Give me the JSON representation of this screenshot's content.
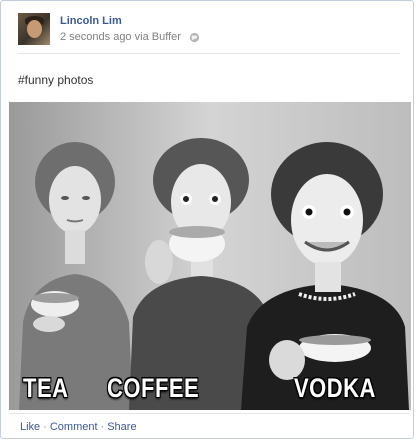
{
  "post": {
    "author": "Lincoln Lim",
    "timestamp": "2 seconds ago",
    "via": "via Buffer",
    "privacy_icon": "globe-icon",
    "message": "#funny photos",
    "photo": {
      "captions": [
        "TEA",
        "COFFEE",
        "VODKA"
      ]
    },
    "actions": {
      "like": "Like",
      "comment": "Comment",
      "share": "Share",
      "separator": "·"
    }
  },
  "colors": {
    "link": "#3b5998",
    "meta": "#808080",
    "border": "#c4cde0"
  }
}
